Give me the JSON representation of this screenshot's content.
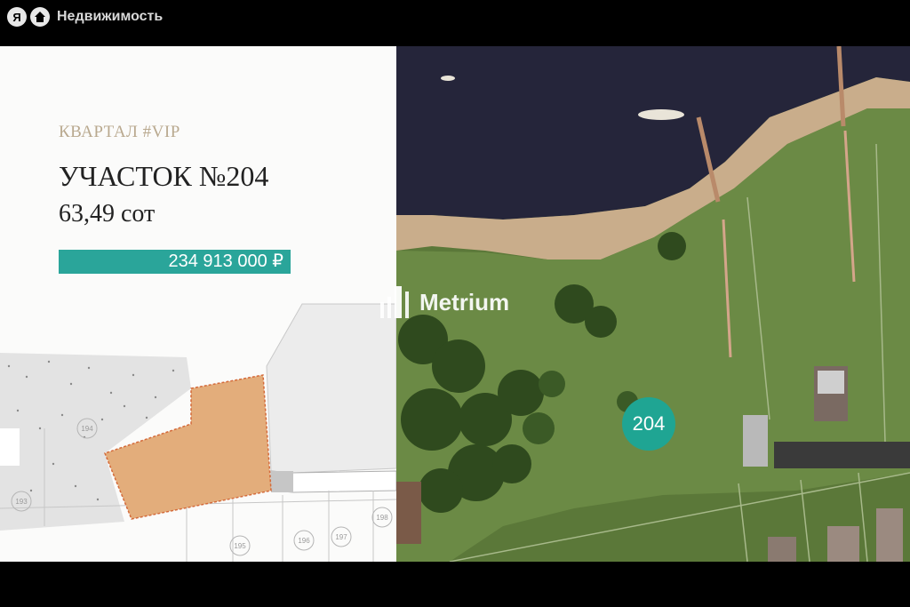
{
  "header": {
    "logo_letter": "Я",
    "brand": "Недвижимость"
  },
  "listing": {
    "quarter": "КВАРТАЛ #VIP",
    "title": "УЧАСТОК №204",
    "area": "63,49 сот",
    "price": "234 913 000 ₽"
  },
  "plan": {
    "lots": [
      "193",
      "194",
      "195",
      "196",
      "197",
      "198"
    ]
  },
  "watermark": "Metrium",
  "badge": "204",
  "colors": {
    "accent": "#2aa59a",
    "badge": "#1fa593",
    "plot_fill": "#e3ad7b",
    "water": "#25253a",
    "grass": "#5f7a3c"
  }
}
